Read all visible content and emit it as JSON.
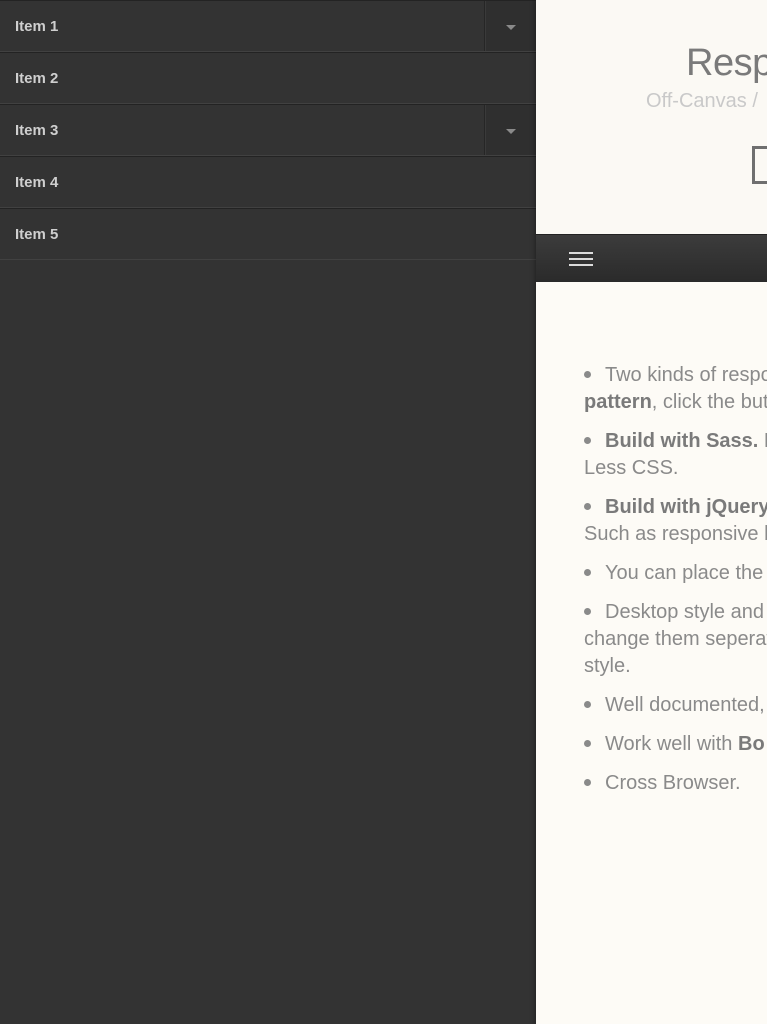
{
  "menu": {
    "items": [
      {
        "label": "Item 1",
        "has_submenu": true
      },
      {
        "label": "Item 2",
        "has_submenu": false
      },
      {
        "label": "Item 3",
        "has_submenu": true
      },
      {
        "label": "Item 4",
        "has_submenu": false
      },
      {
        "label": "Item 5",
        "has_submenu": false
      }
    ]
  },
  "header": {
    "title": "Resp",
    "subtitle": "Off-Canvas /"
  },
  "navbar": {
    "menu_icon": "hamburger-icon"
  },
  "features": [
    {
      "pre": "Two kinds of respo",
      "line2_bold": "pattern",
      "line2_rest": ", click the but"
    },
    {
      "bold": "Build with Sass.",
      "rest": " E",
      "line2": "Less CSS."
    },
    {
      "bold": "Build with jQuery",
      "rest": "",
      "line2": "Such as responsive b"
    },
    {
      "text": "You can place the r"
    },
    {
      "text": "Desktop style and",
      "line2": "change them seperat",
      "line3": "style."
    },
    {
      "text": "Well documented,"
    },
    {
      "pre": "Work well with ",
      "bold": "Bo"
    },
    {
      "text": "Cross Browser."
    }
  ],
  "colors": {
    "menu_bg": "#333333",
    "page_bg": "#fdfbf6",
    "navbar_bg": "#333333",
    "text_muted": "#8a8a8a"
  }
}
